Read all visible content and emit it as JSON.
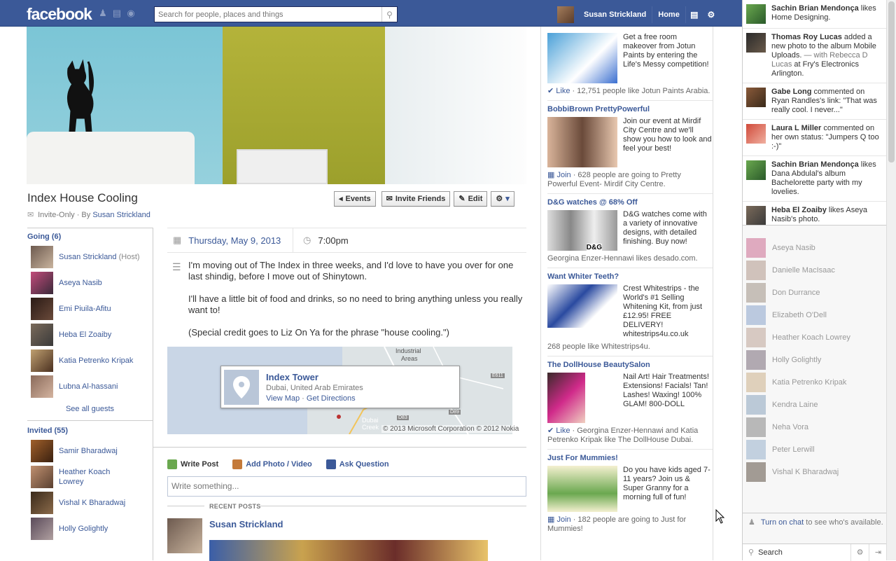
{
  "header": {
    "logo": "facebook",
    "search_placeholder": "Search for people, places and things",
    "user_name": "Susan Strickland",
    "home": "Home"
  },
  "event": {
    "title": "Index House Cooling",
    "privacy": "Invite-Only · By ",
    "host_link": "Susan Strickland",
    "actions": {
      "events": "Events",
      "invite": "Invite Friends",
      "edit": "Edit"
    },
    "date": "Thursday, May 9, 2013",
    "time": "7:00pm",
    "desc": [
      "I'm moving out of The Index in three weeks, and I'd love to have you over for one last shindig, before I move out of Shinytown.",
      "I'll have a little bit of food and drinks, so no need to bring anything unless you really want to!",
      "(Special credit goes to Liz On Ya for the phrase \"house cooling.\")"
    ],
    "location": {
      "name": "Index Tower",
      "address": "Dubai, United Arab Emirates",
      "view_map": "View Map",
      "sep": " · ",
      "directions": "Get Directions",
      "copyright": "© 2013 Microsoft Corporation © 2012 Nokia",
      "map_labels": {
        "industrial": "Industrial",
        "areas": "Areas",
        "e611": "E611",
        "d83": "D83",
        "d89": "D89",
        "dubai": "Dubai",
        "creek": "Creek"
      }
    }
  },
  "going": {
    "header": "Going (6)",
    "host_tag": "(Host)",
    "guests": [
      "Susan Strickland",
      "Aseya Nasib",
      "Emi Piuila-Afitu",
      "Heba El Zoaiby",
      "Katia Petrenko Kripak",
      "Lubna Al-hassani"
    ],
    "see_all": "See all guests"
  },
  "invited": {
    "header": "Invited (55)",
    "guests": [
      "Samir Bharadwaj",
      "Heather Koach Lowrey",
      "Vishal K Bharadwaj",
      "Holly Golightly"
    ]
  },
  "composer": {
    "write_post": "Write Post",
    "add_photo": "Add Photo / Video",
    "ask_question": "Ask Question",
    "placeholder": "Write something...",
    "recent_posts": "RECENT POSTS",
    "post_author": "Susan Strickland"
  },
  "ads": [
    {
      "title": "",
      "body": "Get a free room makeover from Jotun Paints by entering the Life's Messy competition!",
      "foot_link": "Like",
      "foot": " · 12,751 people like Jotun Paints Arabia."
    },
    {
      "title": "BobbiBrown PrettyPowerful",
      "body": "Join our event at Mirdif City Centre and we'll show you how to look and feel your best!",
      "foot_link": "Join",
      "foot": " · 628 people are going to Pretty Powerful Event- Mirdif City Centre."
    },
    {
      "title": "D&G watches @ 68% Off",
      "body": "D&G watches come with a variety of innovative designs, with detailed finishing. Buy now!",
      "foot_link": "",
      "foot": "Georgina Enzer-Hennawi likes desado.com.",
      "brand": "D&G"
    },
    {
      "title": "Want Whiter Teeth?",
      "body": "Crest Whitestrips - the World's #1 Selling Whitening Kit, from just £12.95! FREE DELIVERY! whitestrips4u.co.uk",
      "foot_link": "",
      "foot": "268 people like Whitestrips4u."
    },
    {
      "title": "The DollHouse BeautySalon",
      "body": "Nail Art! Hair Treatments! Extensions! Facials! Tan! Lashes! Waxing! 100% GLAM! 800-DOLL",
      "foot_link": "Like",
      "foot": " · Georgina Enzer-Hennawi and Katia Petrenko Kripak like The DollHouse Dubai."
    },
    {
      "title": "Just For Mummies!",
      "body": "Do you have kids aged 7-11 years? Join us & Super Granny for a morning full of fun!",
      "foot_link": "Join",
      "foot": " · 182 people are going to Just for Mummies!"
    }
  ],
  "ticker": [
    {
      "name": "Sachin Brian Mendonça",
      "rest": " likes Home Designing."
    },
    {
      "name": "Thomas Roy Lucas",
      "rest": " added a new photo to the album Mobile Uploads.",
      "dim": " — with Rebecca D Lucas",
      "tail": " at Fry's Electronics Arlington."
    },
    {
      "name": "Gabe Long",
      "rest": " commented on Ryan Randles's link: \"That was really cool. I never...\""
    },
    {
      "name": "Laura L Miller",
      "rest": " commented on her own status: \"Jumpers Q too :-)\""
    },
    {
      "name": "Sachin Brian Mendonça",
      "rest": " likes Dana Abdulal's album Bachelorette party with my lovelies."
    },
    {
      "name": "Heba El Zoaiby",
      "rest": " likes Aseya Nasib's photo."
    }
  ],
  "chat": {
    "friends": [
      "Aseya Nasib",
      "Danielle MacIsaac",
      "Don Durrance",
      "Elizabeth O'Dell",
      "Heather Koach Lowrey",
      "Holly Golightly",
      "Katia Petrenko Kripak",
      "Kendra Laine",
      "Neha Vora",
      "Peter Lerwill",
      "Vishal K Bharadwaj"
    ],
    "turn_on": "Turn on chat",
    "turn_on_rest": " to see who's available.",
    "search": "Search"
  },
  "colors": {
    "brand": "#3b5998",
    "link": "#3b5998"
  }
}
